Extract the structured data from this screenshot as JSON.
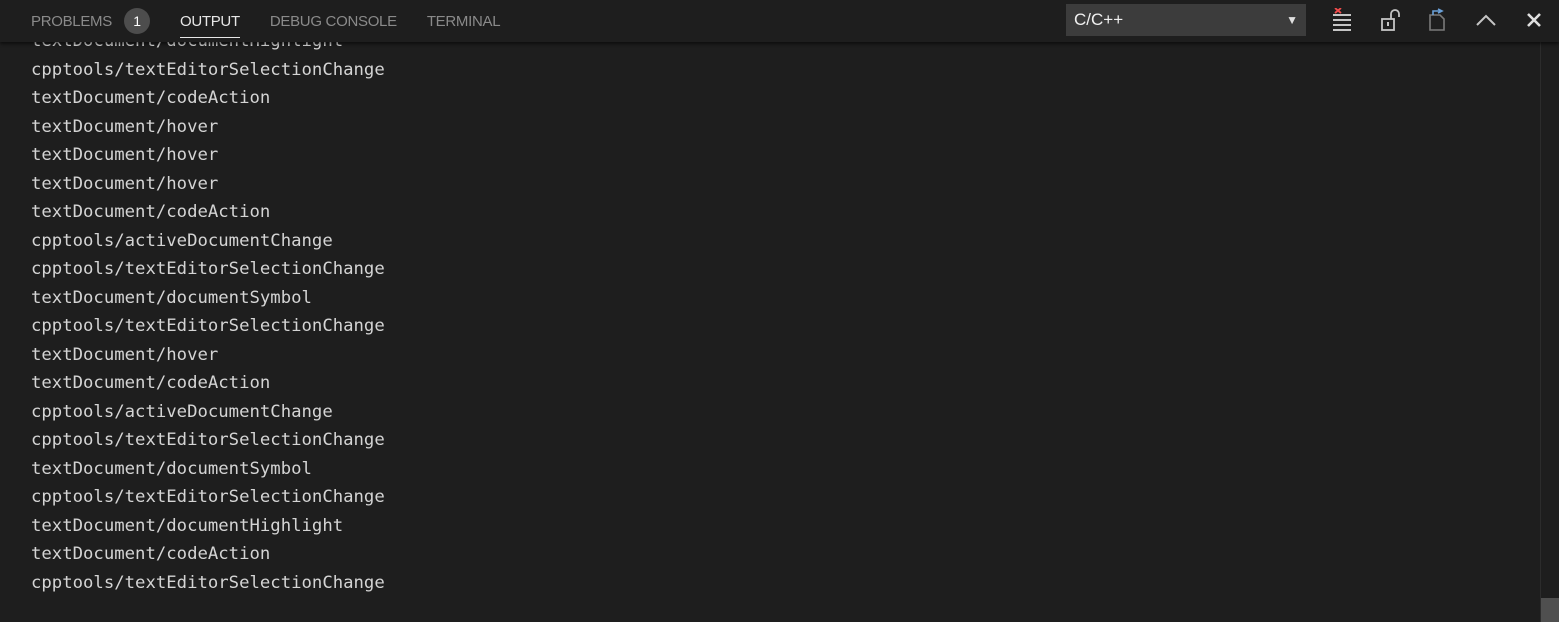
{
  "tabs": [
    {
      "label": "PROBLEMS",
      "badge": "1"
    },
    {
      "label": "OUTPUT"
    },
    {
      "label": "DEBUG CONSOLE"
    },
    {
      "label": "TERMINAL"
    }
  ],
  "active_tab": "OUTPUT",
  "channel_select": {
    "value": "C/C++",
    "arrow": "▼"
  },
  "actions": {
    "clear_output": "clear-output-icon",
    "scroll_lock": "unlock-icon",
    "open_log": "open-log-file-icon",
    "maximize": "chevron-up-icon",
    "close": "close-icon"
  },
  "output_lines": [
    "textDocument/documentHighlight",
    "cpptools/textEditorSelectionChange",
    "textDocument/codeAction",
    "textDocument/hover",
    "textDocument/hover",
    "textDocument/hover",
    "textDocument/codeAction",
    "cpptools/activeDocumentChange",
    "cpptools/textEditorSelectionChange",
    "textDocument/documentSymbol",
    "cpptools/textEditorSelectionChange",
    "textDocument/hover",
    "textDocument/codeAction",
    "cpptools/activeDocumentChange",
    "cpptools/textEditorSelectionChange",
    "textDocument/documentSymbol",
    "cpptools/textEditorSelectionChange",
    "textDocument/documentHighlight",
    "textDocument/codeAction",
    "cpptools/textEditorSelectionChange"
  ],
  "colors": {
    "background": "#1e1e1e",
    "text": "#d4d4d4",
    "badge": "#4d4d4d",
    "select_bg": "#3c3c3c",
    "clear_x": "#f14c4c"
  }
}
